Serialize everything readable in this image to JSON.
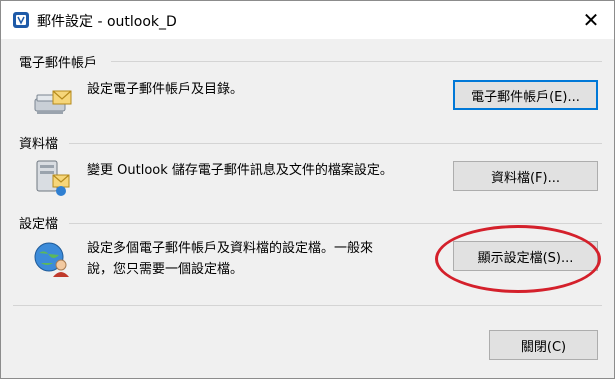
{
  "window": {
    "title": "郵件設定 - outlook_D",
    "close_glyph": "✕"
  },
  "sections": [
    {
      "label": "電子郵件帳戶",
      "description": "設定電子郵件帳戶及目錄。",
      "button": "電子郵件帳戶(E)...",
      "icon": "email-envelope-icon"
    },
    {
      "label": "資料檔",
      "description": "變更 Outlook 儲存電子郵件訊息及文件的檔案設定。",
      "button": "資料檔(F)...",
      "icon": "data-file-icon"
    },
    {
      "label": "設定檔",
      "description_line1": "設定多個電子郵件帳戶及資料檔的設定檔。一般來",
      "description_line2": "說，您只需要一個設定檔。",
      "button": "顯示設定檔(S)...",
      "icon": "profile-globe-icon"
    }
  ],
  "footer": {
    "close_button": "關閉(C)"
  },
  "annotation": {
    "type": "red-ellipse",
    "color": "#d4202b",
    "target": "show-profiles-button"
  },
  "colors": {
    "focus_border": "#0078d7",
    "button_bg": "#e1e1e1",
    "window_bg": "#f0f0f0"
  }
}
